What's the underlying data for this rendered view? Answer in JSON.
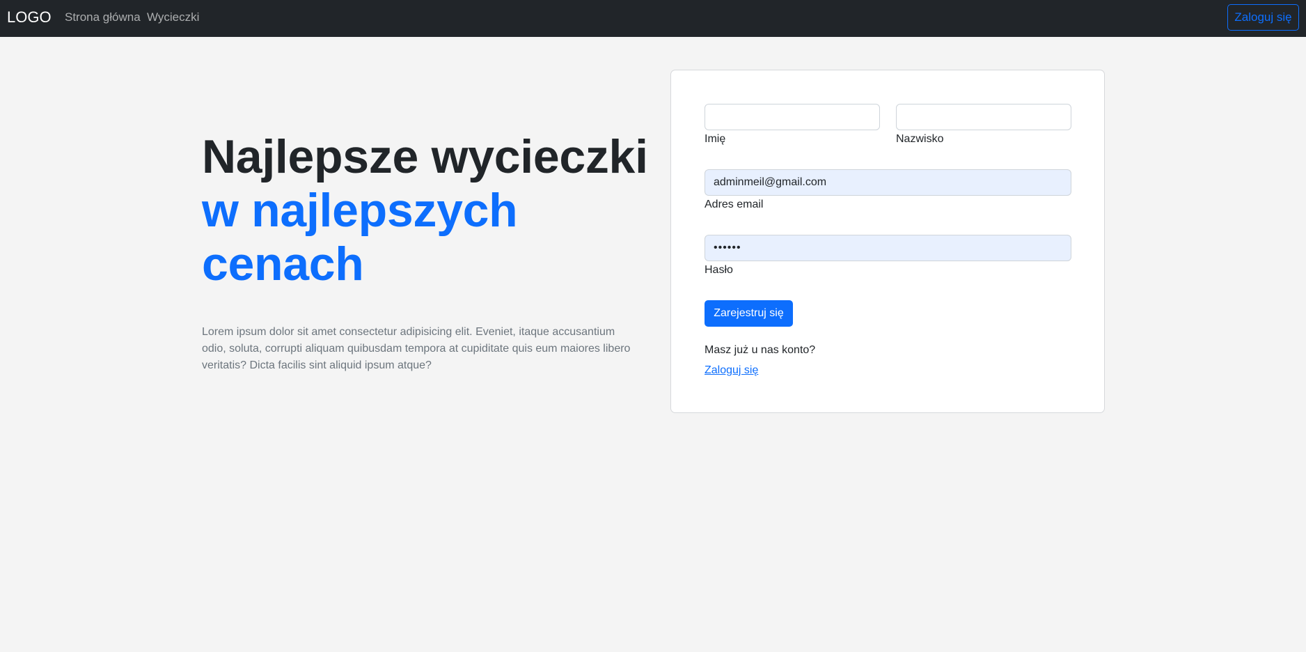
{
  "navbar": {
    "brand": "LOGO",
    "links": [
      {
        "label": "Strona główna"
      },
      {
        "label": "Wycieczki"
      }
    ],
    "login_button": "Zaloguj się"
  },
  "hero": {
    "title_line1": "Najlepsze wycieczki",
    "title_line2": "w najlepszych cenach",
    "lead": "Lorem ipsum dolor sit amet consectetur adipisicing elit. Eveniet, itaque accusantium odio, soluta, corrupti aliquam quibusdam tempora at cupiditate quis eum maiores libero veritatis? Dicta facilis sint aliquid ipsum atque?"
  },
  "form": {
    "first_name": {
      "label": "Imię",
      "value": ""
    },
    "last_name": {
      "label": "Nazwisko",
      "value": ""
    },
    "email": {
      "label": "Adres email",
      "value": "adminmeil@gmail.com"
    },
    "password": {
      "label": "Hasło",
      "value": "••••••"
    },
    "submit_label": "Zarejestruj się",
    "has_account_text": "Masz już u nas konto?",
    "login_link": "Zaloguj się"
  },
  "colors": {
    "accent": "#0d6efd",
    "navbar_bg": "#212529",
    "page_bg": "#f4f4f4",
    "autofill_bg": "#e8f0fe"
  }
}
